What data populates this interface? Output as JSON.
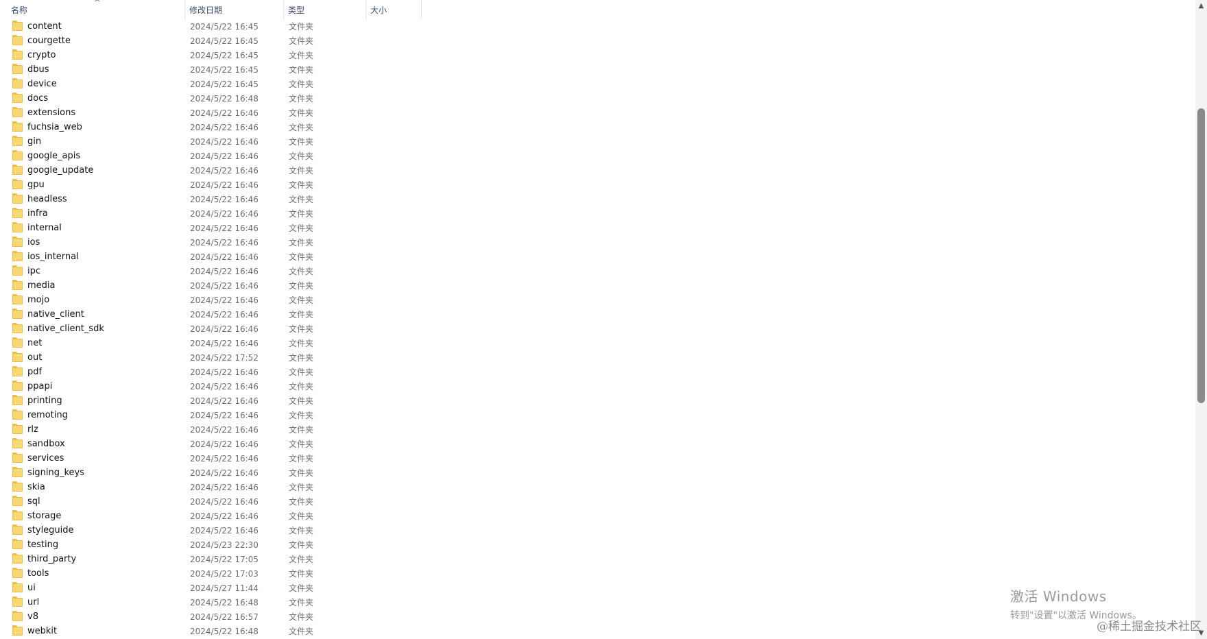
{
  "columns": {
    "name": "名称",
    "date": "修改日期",
    "type": "类型",
    "size": "大小"
  },
  "sort_icon": "chevron-up-icon",
  "rows": [
    {
      "name": "content",
      "date": "2024/5/22 16:45",
      "type": "文件夹"
    },
    {
      "name": "courgette",
      "date": "2024/5/22 16:45",
      "type": "文件夹"
    },
    {
      "name": "crypto",
      "date": "2024/5/22 16:45",
      "type": "文件夹"
    },
    {
      "name": "dbus",
      "date": "2024/5/22 16:45",
      "type": "文件夹"
    },
    {
      "name": "device",
      "date": "2024/5/22 16:45",
      "type": "文件夹"
    },
    {
      "name": "docs",
      "date": "2024/5/22 16:48",
      "type": "文件夹"
    },
    {
      "name": "extensions",
      "date": "2024/5/22 16:46",
      "type": "文件夹"
    },
    {
      "name": "fuchsia_web",
      "date": "2024/5/22 16:46",
      "type": "文件夹"
    },
    {
      "name": "gin",
      "date": "2024/5/22 16:46",
      "type": "文件夹"
    },
    {
      "name": "google_apis",
      "date": "2024/5/22 16:46",
      "type": "文件夹"
    },
    {
      "name": "google_update",
      "date": "2024/5/22 16:46",
      "type": "文件夹"
    },
    {
      "name": "gpu",
      "date": "2024/5/22 16:46",
      "type": "文件夹"
    },
    {
      "name": "headless",
      "date": "2024/5/22 16:46",
      "type": "文件夹"
    },
    {
      "name": "infra",
      "date": "2024/5/22 16:46",
      "type": "文件夹"
    },
    {
      "name": "internal",
      "date": "2024/5/22 16:46",
      "type": "文件夹"
    },
    {
      "name": "ios",
      "date": "2024/5/22 16:46",
      "type": "文件夹"
    },
    {
      "name": "ios_internal",
      "date": "2024/5/22 16:46",
      "type": "文件夹"
    },
    {
      "name": "ipc",
      "date": "2024/5/22 16:46",
      "type": "文件夹"
    },
    {
      "name": "media",
      "date": "2024/5/22 16:46",
      "type": "文件夹"
    },
    {
      "name": "mojo",
      "date": "2024/5/22 16:46",
      "type": "文件夹"
    },
    {
      "name": "native_client",
      "date": "2024/5/22 16:46",
      "type": "文件夹"
    },
    {
      "name": "native_client_sdk",
      "date": "2024/5/22 16:46",
      "type": "文件夹"
    },
    {
      "name": "net",
      "date": "2024/5/22 16:46",
      "type": "文件夹"
    },
    {
      "name": "out",
      "date": "2024/5/22 17:52",
      "type": "文件夹"
    },
    {
      "name": "pdf",
      "date": "2024/5/22 16:46",
      "type": "文件夹"
    },
    {
      "name": "ppapi",
      "date": "2024/5/22 16:46",
      "type": "文件夹"
    },
    {
      "name": "printing",
      "date": "2024/5/22 16:46",
      "type": "文件夹"
    },
    {
      "name": "remoting",
      "date": "2024/5/22 16:46",
      "type": "文件夹"
    },
    {
      "name": "rlz",
      "date": "2024/5/22 16:46",
      "type": "文件夹"
    },
    {
      "name": "sandbox",
      "date": "2024/5/22 16:46",
      "type": "文件夹"
    },
    {
      "name": "services",
      "date": "2024/5/22 16:46",
      "type": "文件夹"
    },
    {
      "name": "signing_keys",
      "date": "2024/5/22 16:46",
      "type": "文件夹"
    },
    {
      "name": "skia",
      "date": "2024/5/22 16:46",
      "type": "文件夹"
    },
    {
      "name": "sql",
      "date": "2024/5/22 16:46",
      "type": "文件夹"
    },
    {
      "name": "storage",
      "date": "2024/5/22 16:46",
      "type": "文件夹"
    },
    {
      "name": "styleguide",
      "date": "2024/5/22 16:46",
      "type": "文件夹"
    },
    {
      "name": "testing",
      "date": "2024/5/23 22:30",
      "type": "文件夹"
    },
    {
      "name": "third_party",
      "date": "2024/5/22 17:05",
      "type": "文件夹"
    },
    {
      "name": "tools",
      "date": "2024/5/22 17:03",
      "type": "文件夹"
    },
    {
      "name": "ui",
      "date": "2024/5/27 11:44",
      "type": "文件夹"
    },
    {
      "name": "url",
      "date": "2024/5/22 16:48",
      "type": "文件夹"
    },
    {
      "name": "v8",
      "date": "2024/5/22 16:57",
      "type": "文件夹"
    },
    {
      "name": "webkit",
      "date": "2024/5/22 16:48",
      "type": "文件夹"
    }
  ],
  "row_icon": "folder-icon",
  "watermark": {
    "title": "激活 Windows",
    "subtitle": "转到\"设置\"以激活 Windows。"
  },
  "site_mark": "@稀土掘金技术社区",
  "colors": {
    "folder": "#f8d775",
    "header_text": "#3a4b6b",
    "meta_text": "#6d6d6d",
    "scroll_thumb": "#8a8a8a"
  }
}
